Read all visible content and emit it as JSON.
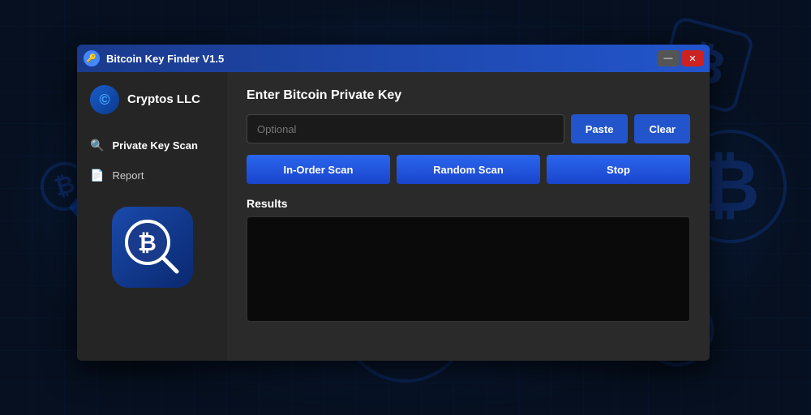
{
  "background": {
    "btc_symbols": [
      "₿",
      "₿",
      "₿",
      "₿",
      "₿"
    ]
  },
  "window": {
    "title": "Bitcoin Key Finder V1.5",
    "titlebar_icon": "🔑",
    "controls": {
      "minimize": "—",
      "close": "✕"
    }
  },
  "sidebar": {
    "brand_name": "Cryptos LLC",
    "nav_items": [
      {
        "label": "Private Key Scan",
        "icon": "🔍",
        "active": true
      },
      {
        "label": "Report",
        "icon": "📄",
        "active": false
      }
    ]
  },
  "main": {
    "section_title": "Enter Bitcoin Private Key",
    "input_placeholder": "Optional",
    "buttons": {
      "paste": "Paste",
      "clear": "Clear",
      "in_order_scan": "In-Order Scan",
      "random_scan": "Random Scan",
      "stop": "Stop"
    },
    "results_label": "Results"
  }
}
